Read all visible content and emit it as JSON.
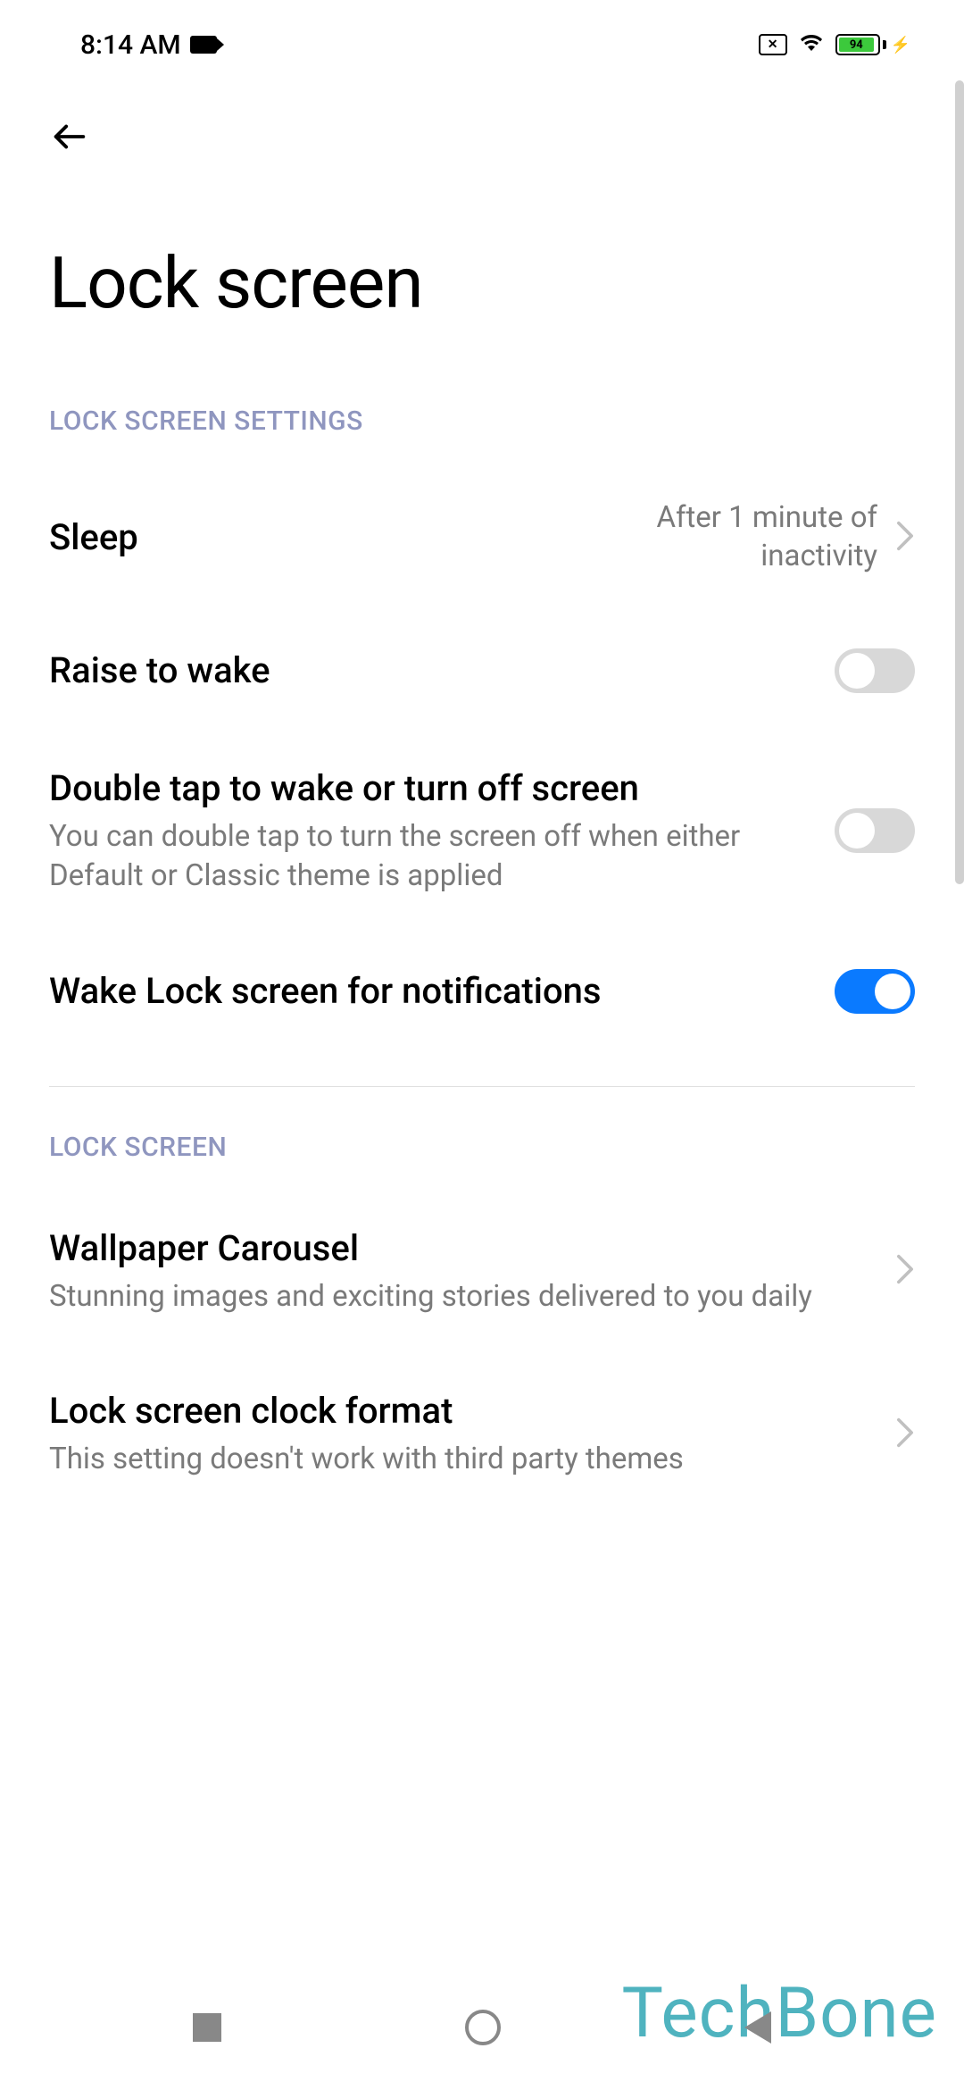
{
  "status_bar": {
    "time": "8:14 AM",
    "battery_percent": "94"
  },
  "page": {
    "title": "Lock screen"
  },
  "sections": [
    {
      "header": "LOCK SCREEN SETTINGS",
      "items": [
        {
          "title": "Sleep",
          "value": "After 1 minute of inactivity",
          "type": "link"
        },
        {
          "title": "Raise to wake",
          "type": "toggle",
          "state": "off"
        },
        {
          "title": "Double tap to wake or turn off screen",
          "subtitle": "You can double tap to turn the screen off when either Default or Classic theme is applied",
          "type": "toggle",
          "state": "off"
        },
        {
          "title": "Wake Lock screen for notifications",
          "type": "toggle",
          "state": "on"
        }
      ]
    },
    {
      "header": "LOCK SCREEN",
      "items": [
        {
          "title": "Wallpaper Carousel",
          "subtitle": "Stunning images and exciting stories delivered to you daily",
          "type": "link"
        },
        {
          "title": "Lock screen clock format",
          "subtitle": "This setting doesn't work with third party themes",
          "type": "link"
        }
      ]
    }
  ],
  "watermark": "TechBone"
}
